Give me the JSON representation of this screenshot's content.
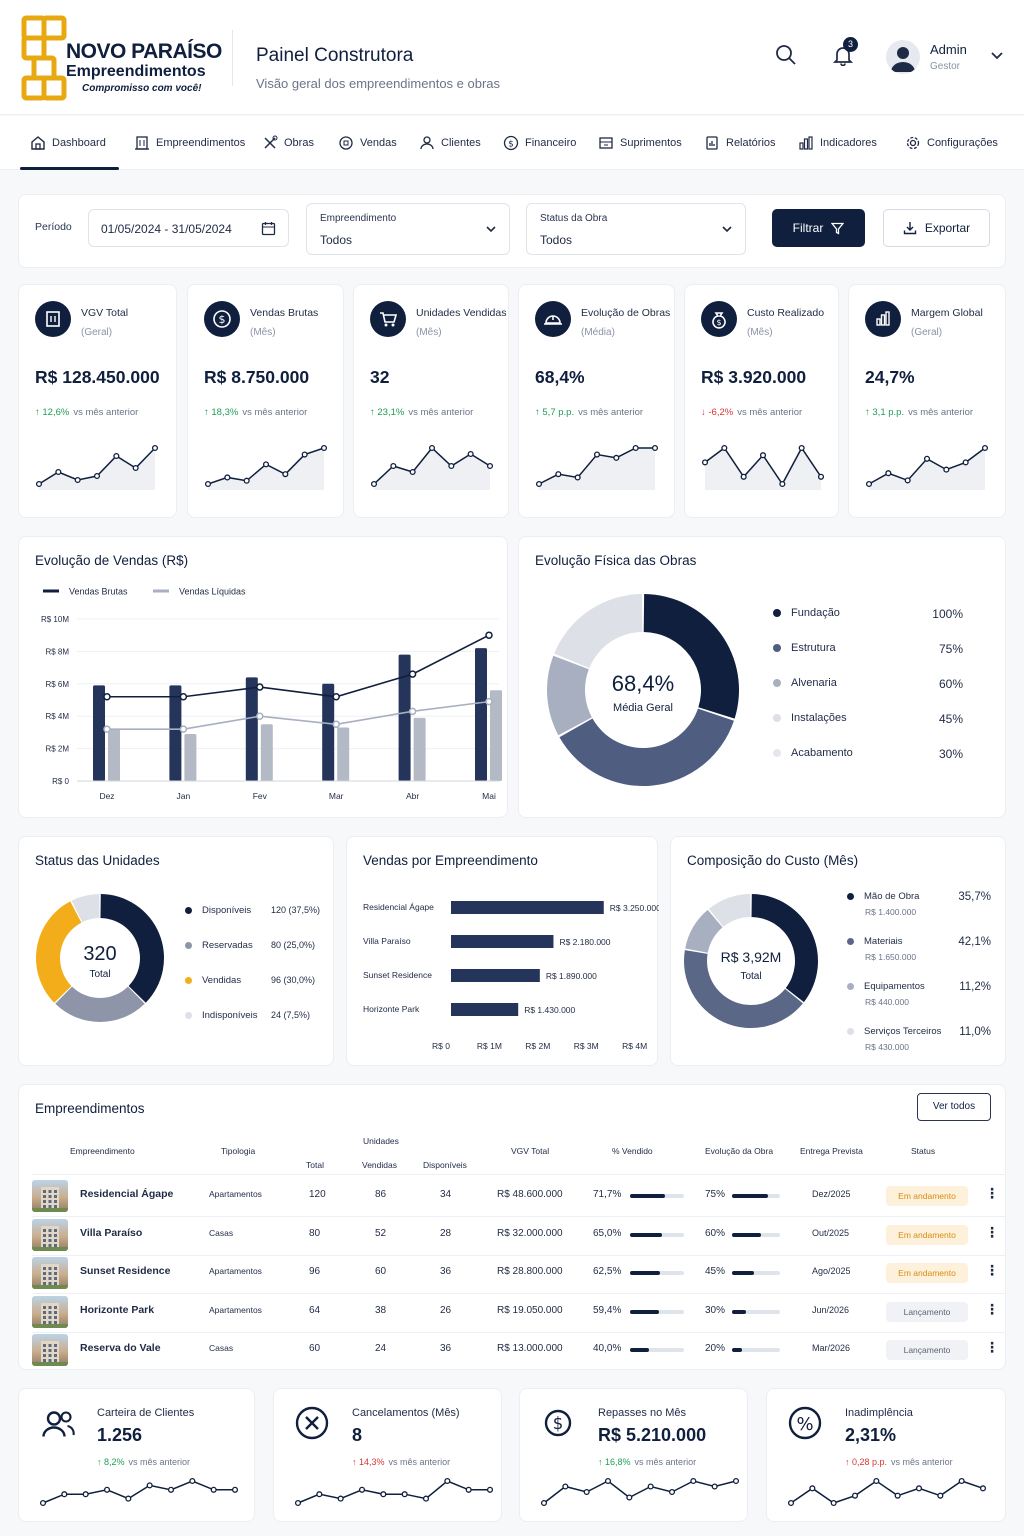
{
  "header": {
    "logo_title": "NOVO PARAÍSO",
    "logo_sub": "Empreendimentos",
    "logo_tag": "Compromisso com você!",
    "title": "Painel Construtora",
    "subtitle": "Visão geral dos empreendimentos e obras",
    "notification_count": "3",
    "user_name": "Admin",
    "user_role": "Gestor"
  },
  "nav": {
    "items": [
      {
        "label": "Dashboard",
        "icon": "home-icon",
        "active": true
      },
      {
        "label": "Empreendimentos",
        "icon": "building-icon"
      },
      {
        "label": "Obras",
        "icon": "tools-icon"
      },
      {
        "label": "Vendas",
        "icon": "tag-icon"
      },
      {
        "label": "Clientes",
        "icon": "user-icon"
      },
      {
        "label": "Financeiro",
        "icon": "dollar-circle-icon"
      },
      {
        "label": "Suprimentos",
        "icon": "box-icon"
      },
      {
        "label": "Relatórios",
        "icon": "report-icon"
      },
      {
        "label": "Indicadores",
        "icon": "bar-chart-icon"
      },
      {
        "label": "Configurações",
        "icon": "gear-icon"
      }
    ]
  },
  "filters": {
    "period_label": "Período",
    "period_value": "01/05/2024 - 31/05/2024",
    "empreendimento_label": "Empreendimento",
    "empreendimento_value": "Todos",
    "status_label": "Status da Obra",
    "status_value": "Todos",
    "filter_button": "Filtrar",
    "export_button": "Exportar"
  },
  "kpis": [
    {
      "title": "VGV Total",
      "sub": "(Geral)",
      "value": "R$ 128.450.000",
      "delta": "12,6%",
      "delta_suffix": "vs mês anterior",
      "dir": "up",
      "icon": "building-icon",
      "spark": [
        3,
        6,
        4,
        5,
        10,
        7,
        12
      ]
    },
    {
      "title": "Vendas Brutas",
      "sub": "(Mês)",
      "value": "R$ 8.750.000",
      "delta": "18,3%",
      "delta_suffix": "vs mês anterior",
      "dir": "up",
      "icon": "dollar-circle-icon",
      "spark": [
        2,
        4,
        3,
        8,
        5,
        11,
        13
      ]
    },
    {
      "title": "Unidades Vendidas",
      "sub": "(Mês)",
      "value": "32",
      "delta": "23,1%",
      "delta_suffix": "vs mês anterior",
      "dir": "up",
      "icon": "cart-icon",
      "spark": [
        3,
        6,
        5,
        9,
        6,
        8,
        6
      ]
    },
    {
      "title": "Evolução de Obras",
      "sub": "(Média)",
      "value": "68,4%",
      "delta": "5,7 p.p.",
      "delta_suffix": "vs mês anterior",
      "dir": "up",
      "icon": "helmet-icon",
      "spark": [
        2,
        5,
        4,
        11,
        10,
        13,
        13
      ]
    },
    {
      "title": "Custo Realizado",
      "sub": "(Mês)",
      "value": "R$ 3.920.000",
      "delta": "-6,2%",
      "delta_suffix": "vs mês anterior",
      "dir": "down",
      "icon": "money-bag-icon",
      "spark": [
        7,
        9,
        5,
        8,
        4,
        9,
        5
      ]
    },
    {
      "title": "Margem Global",
      "sub": "(Geral)",
      "value": "24,7%",
      "delta": "3,1 p.p.",
      "delta_suffix": "vs mês anterior",
      "dir": "up",
      "icon": "bar-chart-icon",
      "spark": [
        4,
        7,
        5,
        11,
        8,
        10,
        14
      ]
    }
  ],
  "colors": {
    "navy": "#0f1f3d",
    "slate": "#4e5d80",
    "gray": "#a8afc0",
    "light": "#dde0e6",
    "amber": "#f3ad1b",
    "green": "#1f9d55",
    "red": "#d93636"
  },
  "chart_data": [
    {
      "type": "bar",
      "title": "Evolução de Vendas (R$)",
      "categories": [
        "Dez",
        "Jan",
        "Fev",
        "Mar",
        "Abr",
        "Mai"
      ],
      "yticks": [
        "R$ 0",
        "R$ 2M",
        "R$ 4M",
        "R$ 6M",
        "R$ 8M",
        "R$ 10M"
      ],
      "ylim": [
        0,
        10
      ],
      "series": [
        {
          "name": "Vendas Brutas",
          "bars": [
            5.9,
            5.9,
            6.4,
            6.0,
            7.8,
            8.2
          ],
          "line": [
            5.2,
            5.2,
            5.8,
            5.2,
            6.6,
            9.0
          ]
        },
        {
          "name": "Vendas Líquidas",
          "bars": [
            3.2,
            2.9,
            3.5,
            3.3,
            3.9,
            5.6
          ],
          "line": [
            3.2,
            3.2,
            4.0,
            3.5,
            4.3,
            4.9
          ]
        }
      ]
    },
    {
      "type": "pie",
      "title": "Evolução Física das Obras",
      "center_value": "68,4%",
      "center_label": "Média Geral",
      "slices": [
        {
          "label": "Fundação",
          "value": "100%",
          "weight": 30,
          "color": "#0f1f3d"
        },
        {
          "label": "Estrutura",
          "value": "75%",
          "weight": 37,
          "color": "#4e5d80"
        },
        {
          "label": "Alvenaria",
          "value": "60%",
          "weight": 14,
          "color": "#a8afc0"
        },
        {
          "label": "Instalações",
          "value": "45%",
          "weight": 19,
          "color": "#dde0e6"
        },
        {
          "label": "Acabamento",
          "value": "30%",
          "weight": 0,
          "color": "#eef0f3"
        }
      ]
    },
    {
      "type": "pie",
      "title": "Status das Unidades",
      "center_value": "320",
      "center_label": "Total",
      "slices": [
        {
          "label": "Disponíveis",
          "value": "120 (37,5%)",
          "weight": 37.5,
          "color": "#0f1f3d"
        },
        {
          "label": "Reservadas",
          "value": "80 (25,0%)",
          "weight": 25,
          "color": "#8e95a8"
        },
        {
          "label": "Vendidas",
          "value": "96 (30,0%)",
          "weight": 30,
          "color": "#f3ad1b"
        },
        {
          "label": "Indisponíveis",
          "value": "24 (7,5%)",
          "weight": 7.5,
          "color": "#dde0e6"
        }
      ]
    },
    {
      "type": "bar",
      "title": "Vendas por Empreendimento",
      "categories": [
        "Residencial Ágape",
        "Villa Paraíso",
        "Sunset Residence",
        "Horizonte Park"
      ],
      "values": [
        3.25,
        2.18,
        1.89,
        1.43
      ],
      "value_labels": [
        "R$ 3.250.000",
        "R$ 2.180.000",
        "R$ 1.890.000",
        "R$ 1.430.000"
      ],
      "xticks": [
        "R$ 0",
        "R$ 1M",
        "R$ 2M",
        "R$ 3M",
        "R$ 4M"
      ],
      "xlim": [
        0,
        4
      ]
    },
    {
      "type": "pie",
      "title": "Composição do Custo (Mês)",
      "center_value": "R$ 3,92M",
      "center_label": "Total",
      "slices": [
        {
          "label": "Mão de Obra",
          "amount": "R$ 1.400.000",
          "value": "35,7%",
          "weight": 35.7,
          "color": "#0f1f3d"
        },
        {
          "label": "Materiais",
          "amount": "R$ 1.650.000",
          "value": "42,1%",
          "weight": 42.1,
          "color": "#5a6787"
        },
        {
          "label": "Equipamentos",
          "amount": "R$ 440.000",
          "value": "11,2%",
          "weight": 11.2,
          "color": "#a8afc0"
        },
        {
          "label": "Serviços Terceiros",
          "amount": "R$ 430.000",
          "value": "11,0%",
          "weight": 11.0,
          "color": "#dde0e6"
        }
      ]
    }
  ],
  "table": {
    "title": "Empreendimentos",
    "view_all": "Ver todos",
    "headers": {
      "name": "Empreendimento",
      "type": "Tipologia",
      "units": "Unidades",
      "total": "Total",
      "sold": "Vendidas",
      "avail": "Disponíveis",
      "vgv": "VGV Total",
      "pct_sold": "% Vendido",
      "progress": "Evolução da Obra",
      "delivery": "Entrega Prevista",
      "status": "Status"
    },
    "rows": [
      {
        "name": "Residencial Ágape",
        "type": "Apartamentos",
        "total": "120",
        "sold": "86",
        "avail": "34",
        "vgv": "R$ 48.600.000",
        "pct": "71,7%",
        "pct_frac": 0.717,
        "prog": "75%",
        "prog_frac": 0.75,
        "delivery": "Dez/2025",
        "status": "Em andamento",
        "status_kind": "amber"
      },
      {
        "name": "Villa Paraíso",
        "type": "Casas",
        "total": "80",
        "sold": "52",
        "avail": "28",
        "vgv": "R$ 32.000.000",
        "pct": "65,0%",
        "pct_frac": 0.65,
        "prog": "60%",
        "prog_frac": 0.6,
        "delivery": "Out/2025",
        "status": "Em andamento",
        "status_kind": "amber"
      },
      {
        "name": "Sunset Residence",
        "type": "Apartamentos",
        "total": "96",
        "sold": "60",
        "avail": "36",
        "vgv": "R$ 28.800.000",
        "pct": "62,5%",
        "pct_frac": 0.625,
        "prog": "45%",
        "prog_frac": 0.45,
        "delivery": "Ago/2025",
        "status": "Em andamento",
        "status_kind": "amber"
      },
      {
        "name": "Horizonte Park",
        "type": "Apartamentos",
        "total": "64",
        "sold": "38",
        "avail": "26",
        "vgv": "R$ 19.050.000",
        "pct": "59,4%",
        "pct_frac": 0.594,
        "prog": "30%",
        "prog_frac": 0.3,
        "delivery": "Jun/2026",
        "status": "Lançamento",
        "status_kind": "gray"
      },
      {
        "name": "Reserva do Vale",
        "type": "Casas",
        "total": "60",
        "sold": "24",
        "avail": "36",
        "vgv": "R$ 13.000.000",
        "pct": "40,0%",
        "pct_frac": 0.4,
        "prog": "20%",
        "prog_frac": 0.2,
        "delivery": "Mar/2026",
        "status": "Lançamento",
        "status_kind": "gray"
      }
    ]
  },
  "bottom": [
    {
      "title": "Carteira de Clientes",
      "value": "1.256",
      "delta": "8,2%",
      "delta_suffix": "vs mês anterior",
      "dir": "up",
      "icon": "users-icon",
      "spark": [
        3,
        5,
        5,
        6,
        4,
        7,
        6,
        8,
        6,
        6
      ]
    },
    {
      "title": "Cancelamentos (Mês)",
      "value": "8",
      "delta": "14,3%",
      "delta_suffix": "vs mês anterior",
      "dir": "up-red",
      "icon": "x-circle-icon",
      "spark": [
        3,
        5,
        4,
        6,
        5,
        5,
        4,
        8,
        6,
        6
      ]
    },
    {
      "title": "Repasses no Mês",
      "value": "R$ 5.210.000",
      "delta": "16,8%",
      "delta_suffix": "vs mês anterior",
      "dir": "up",
      "icon": "dollar-circle-icon",
      "spark": [
        3,
        6,
        5,
        7,
        4,
        6,
        5,
        7,
        6,
        7
      ]
    },
    {
      "title": "Inadimplência",
      "value": "2,31%",
      "delta": "0,28 p.p.",
      "delta_suffix": "vs mês anterior",
      "dir": "up-red",
      "icon": "percent-icon",
      "spark": [
        4,
        6,
        4,
        5,
        7,
        5,
        6,
        5,
        7,
        6
      ]
    }
  ]
}
